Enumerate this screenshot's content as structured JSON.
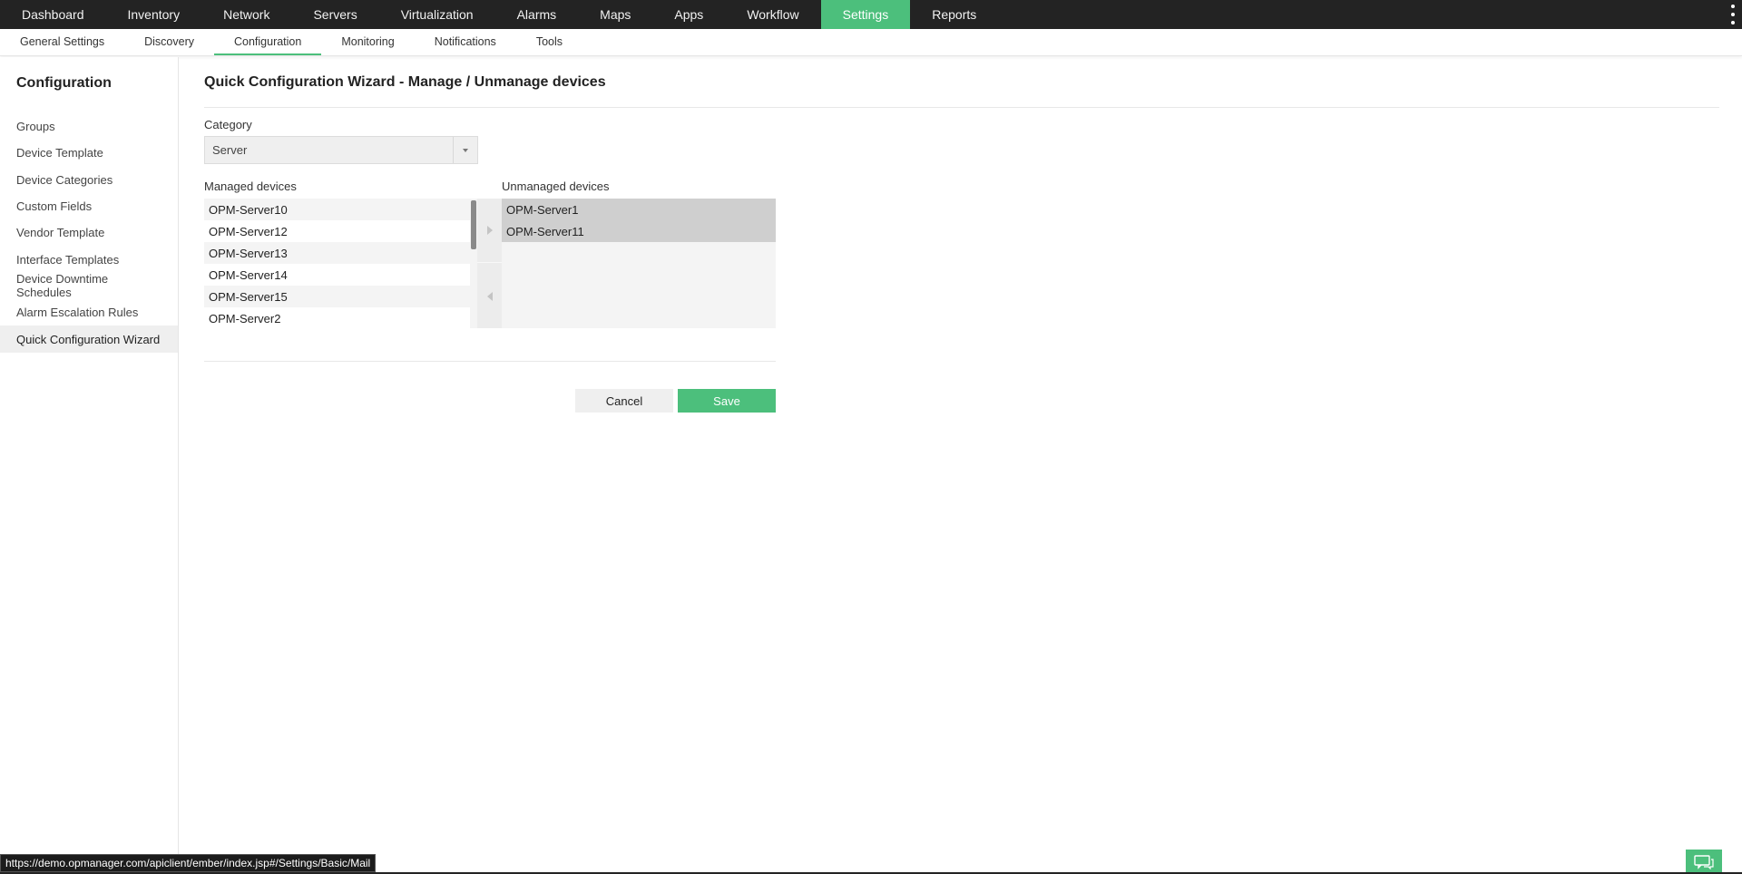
{
  "topnav": {
    "items": [
      "Dashboard",
      "Inventory",
      "Network",
      "Servers",
      "Virtualization",
      "Alarms",
      "Maps",
      "Apps",
      "Workflow",
      "Settings",
      "Reports"
    ],
    "active_index": 9
  },
  "subnav": {
    "items": [
      "General Settings",
      "Discovery",
      "Configuration",
      "Monitoring",
      "Notifications",
      "Tools"
    ],
    "active_index": 2
  },
  "sidebar": {
    "title": "Configuration",
    "items": [
      "Groups",
      "Device Template",
      "Device Categories",
      "Custom Fields",
      "Vendor Template",
      "Interface Templates",
      "Device Downtime Schedules",
      "Alarm Escalation Rules",
      "Quick Configuration Wizard"
    ],
    "active_index": 8
  },
  "main": {
    "title": "Quick Configuration Wizard - Manage / Unmanage devices",
    "category_label": "Category",
    "category_value": "Server",
    "managed_label": "Managed devices",
    "unmanaged_label": "Unmanaged devices",
    "managed_devices": [
      "OPM-Server10",
      "OPM-Server12",
      "OPM-Server13",
      "OPM-Server14",
      "OPM-Server15",
      "OPM-Server2"
    ],
    "unmanaged_devices": [
      "OPM-Server1",
      "OPM-Server11"
    ],
    "cancel_label": "Cancel",
    "save_label": "Save"
  },
  "status_url": "https://demo.opmanager.com/apiclient/ember/index.jsp#/Settings/Basic/Mail",
  "colors": {
    "accent": "#4cbf7c",
    "topbar": "#232323"
  },
  "icons": {
    "more": "vertical-dots-icon",
    "chat": "chat-bubble-icon"
  }
}
